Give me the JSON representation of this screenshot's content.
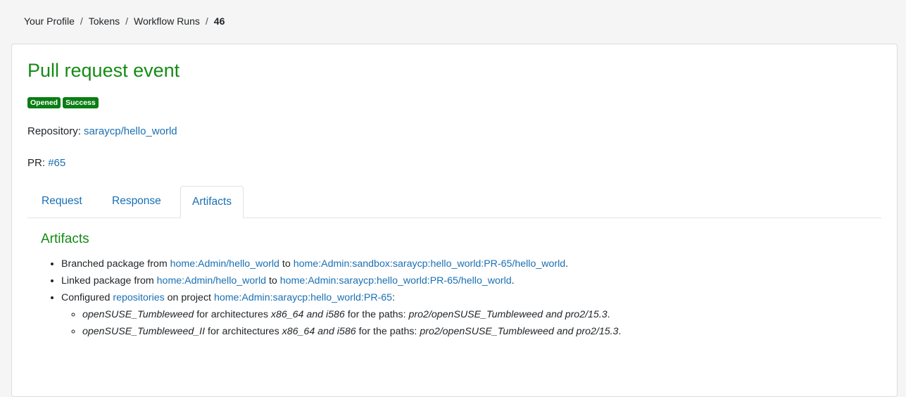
{
  "breadcrumb": {
    "items": [
      "Your Profile",
      "Tokens",
      "Workflow Runs"
    ],
    "separator": "/",
    "current": "46"
  },
  "event": {
    "title": "Pull request event",
    "badges": [
      "Opened",
      "Success"
    ],
    "repository_label": "Repository:",
    "repository": "saraycp/hello_world",
    "pr_label": "PR:",
    "pr": "#65"
  },
  "tabs": {
    "items": [
      "Request",
      "Response",
      "Artifacts"
    ],
    "active": "Artifacts"
  },
  "artifacts": {
    "title": "Artifacts",
    "branched": {
      "prefix": "Branched package from",
      "source": "home:Admin/hello_world",
      "middle": "to",
      "target": "home:Admin:sandbox:saraycp:hello_world:PR-65/hello_world",
      "suffix": "."
    },
    "linked": {
      "prefix": "Linked package from",
      "source": "home:Admin/hello_world",
      "middle": "to",
      "target": "home:Admin:saraycp:hello_world:PR-65/hello_world",
      "suffix": "."
    },
    "configured": {
      "prefix": "Configured",
      "link": "repositories",
      "middle": "on project",
      "project": "home:Admin:saraycp:hello_world:PR-65",
      "suffix": ":"
    },
    "repos": [
      {
        "name": "openSUSE_Tumbleweed",
        "arch_label": "for architectures",
        "archs": "x86_64 and i586",
        "paths_label": "for the paths:",
        "paths": "pro2/openSUSE_Tumbleweed and pro2/15.3",
        "suffix": "."
      },
      {
        "name": "openSUSE_Tumbleweed_II",
        "arch_label": "for architectures",
        "archs": "x86_64 and i586",
        "paths_label": "for the paths:",
        "paths": "pro2/openSUSE_Tumbleweed and pro2/15.3",
        "suffix": "."
      }
    ]
  },
  "colors": {
    "accent_green": "#158b15",
    "badge_green": "#0a7e14",
    "link_blue": "#1a6fb3"
  }
}
